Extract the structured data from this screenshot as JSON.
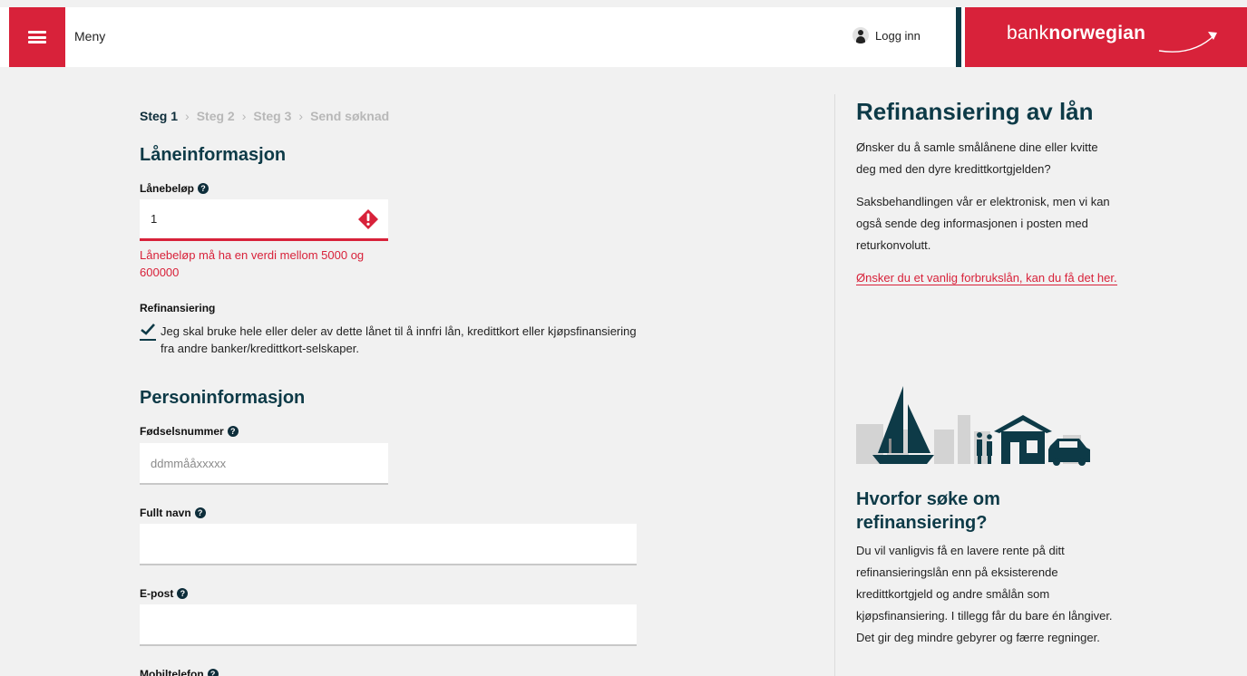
{
  "header": {
    "menu_label": "Meny",
    "login_label": "Logg inn",
    "brand_light": "bank",
    "brand_bold": "norwegian"
  },
  "steps": [
    "Steg 1",
    "Steg 2",
    "Steg 3",
    "Send søknad"
  ],
  "loan": {
    "heading": "Låneinformasjon",
    "amount_label": "Lånebeløp",
    "amount_value": "1",
    "amount_error": "Lånebeløp må ha en verdi mellom 5000 og 600000",
    "refinance_label": "Refinansiering",
    "refinance_text": "Jeg skal bruke hele eller deler av dette lånet til å innfri lån, kredittkort eller kjøpsfinansiering fra andre banker/kredittkort-selskaper.",
    "refinance_checked": true
  },
  "person": {
    "heading": "Personinformasjon",
    "ssn_label": "Fødselsnummer",
    "ssn_placeholder": "ddmmååxxxxx",
    "name_label": "Fullt navn",
    "email_label": "E-post",
    "phone_label": "Mobiltelefon"
  },
  "sidebar": {
    "title": "Refinansiering av lån",
    "para1": "Ønsker du å samle smålånene dine eller kvitte deg med den dyre kredittkortgjelden?",
    "para2": "Saksbehandlingen vår er elektronisk, men vi kan også sende deg informasjonen i posten med returkonvolutt.",
    "link": "Ønsker du et vanlig forbrukslån, kan du få det her.",
    "why_title": "Hvorfor søke om refinansiering?",
    "why_text": "Du vil vanligvis få en lavere rente på ditt refinansieringslån enn på eksisterende kredittkortgjeld og andre smålån som kjøpsfinansiering. I tillegg får du bare én långiver. Det gir deg mindre gebyrer og færre regninger."
  },
  "colors": {
    "brand_red": "#d8223a",
    "navy": "#0d3a47",
    "background": "#f1f1f1"
  },
  "icons": [
    "menu-icon",
    "user-icon",
    "help-icon",
    "error-icon",
    "checkmark-icon"
  ]
}
